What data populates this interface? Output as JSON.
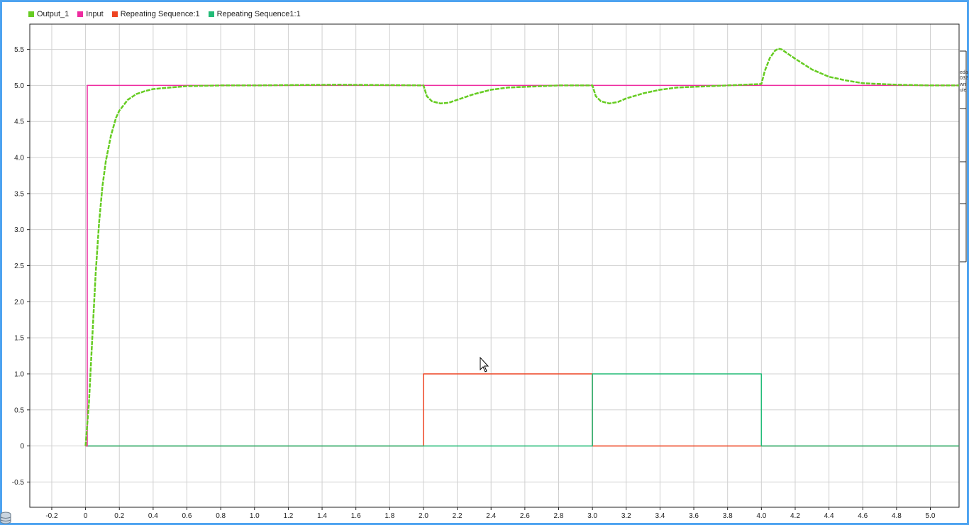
{
  "chart_data": {
    "type": "line",
    "title": "",
    "xlabel": "",
    "ylabel": "",
    "xlim": [
      -0.33,
      5.17
    ],
    "ylim": [
      -0.85,
      5.85
    ],
    "xticks": [
      -0.2,
      0,
      0.2,
      0.4,
      0.6,
      0.8,
      1.0,
      1.2,
      1.4,
      1.6,
      1.8,
      2.0,
      2.2,
      2.4,
      2.6,
      2.8,
      3.0,
      3.2,
      3.4,
      3.6,
      3.8,
      4.0,
      4.2,
      4.4,
      4.6,
      4.8,
      5.0
    ],
    "xtick_labels": [
      "-0.2",
      "0",
      "0.2",
      "0.4",
      "0.6",
      "0.8",
      "1.0",
      "1.2",
      "1.4",
      "1.6",
      "1.8",
      "2.0",
      "2.2",
      "2.4",
      "2.6",
      "2.8",
      "3.0",
      "3.2",
      "3.4",
      "3.6",
      "3.8",
      "4.0",
      "4.2",
      "4.4",
      "4.6",
      "4.8",
      "5.0"
    ],
    "yticks": [
      -0.5,
      0,
      0.5,
      1.0,
      1.5,
      2.0,
      2.5,
      3.0,
      3.5,
      4.0,
      4.5,
      5.0,
      5.5
    ],
    "ytick_labels": [
      "-0.5",
      "0",
      "0.5",
      "1.0",
      "1.5",
      "2.0",
      "2.5",
      "3.0",
      "3.5",
      "4.0",
      "4.5",
      "5.0",
      "5.5"
    ],
    "grid": true,
    "legend_placement": "top-left",
    "series": [
      {
        "name": "Output_1",
        "color": "#66cc22",
        "x": [
          0,
          0.02,
          0.04,
          0.06,
          0.08,
          0.1,
          0.12,
          0.15,
          0.18,
          0.2,
          0.25,
          0.3,
          0.35,
          0.4,
          0.5,
          0.6,
          0.8,
          1.0,
          1.5,
          2.0,
          2.02,
          2.05,
          2.1,
          2.15,
          2.2,
          2.3,
          2.4,
          2.5,
          2.6,
          2.8,
          3.0,
          3.02,
          3.05,
          3.1,
          3.15,
          3.2,
          3.3,
          3.4,
          3.5,
          3.6,
          3.8,
          4.0,
          4.02,
          4.05,
          4.08,
          4.1,
          4.12,
          4.15,
          4.2,
          4.3,
          4.4,
          4.5,
          4.6,
          4.8,
          5.0,
          5.17
        ],
        "values": [
          0,
          0.6,
          1.5,
          2.4,
          3.1,
          3.6,
          3.95,
          4.3,
          4.55,
          4.65,
          4.8,
          4.88,
          4.92,
          4.95,
          4.97,
          4.99,
          5.0,
          5.0,
          5.01,
          5.0,
          4.85,
          4.78,
          4.75,
          4.76,
          4.8,
          4.88,
          4.94,
          4.97,
          4.98,
          5.0,
          5.0,
          4.85,
          4.78,
          4.75,
          4.77,
          4.82,
          4.89,
          4.94,
          4.97,
          4.98,
          5.0,
          5.02,
          5.2,
          5.38,
          5.48,
          5.51,
          5.5,
          5.45,
          5.37,
          5.22,
          5.12,
          5.07,
          5.03,
          5.01,
          5.0,
          5.0
        ]
      },
      {
        "name": "Input",
        "color": "#ee2ca0",
        "x": [
          0.0,
          0.0,
          0.01,
          0.01,
          5.17
        ],
        "values": [
          0,
          0,
          0,
          5.0,
          5.0
        ]
      },
      {
        "name": "Repeating Sequence:1",
        "color": "#ee4422",
        "x": [
          0.0,
          2.0,
          2.0,
          3.0,
          3.0,
          5.17
        ],
        "values": [
          0,
          0,
          1.0,
          1.0,
          0,
          0
        ]
      },
      {
        "name": "Repeating Sequence1:1",
        "color": "#22bb77",
        "x": [
          0.0,
          3.0,
          3.0,
          4.0,
          4.0,
          5.17
        ],
        "values": [
          0,
          0,
          1.0,
          1.0,
          0,
          0
        ]
      }
    ]
  },
  "legend": {
    "items": [
      {
        "label": "Output_1",
        "color": "#66cc22"
      },
      {
        "label": "Input",
        "color": "#ee2ca0"
      },
      {
        "label": "Repeating Sequence:1",
        "color": "#ee4422"
      },
      {
        "label": "Repeating Sequence1:1",
        "color": "#22bb77"
      }
    ]
  },
  "side_text": {
    "line1": "eda",
    "line2": "032",
    "line3": "wri",
    "line4": "ule"
  },
  "colors": {
    "frame_border": "#4da3f0",
    "grid": "#d0d0d0",
    "axis": "#222222"
  }
}
